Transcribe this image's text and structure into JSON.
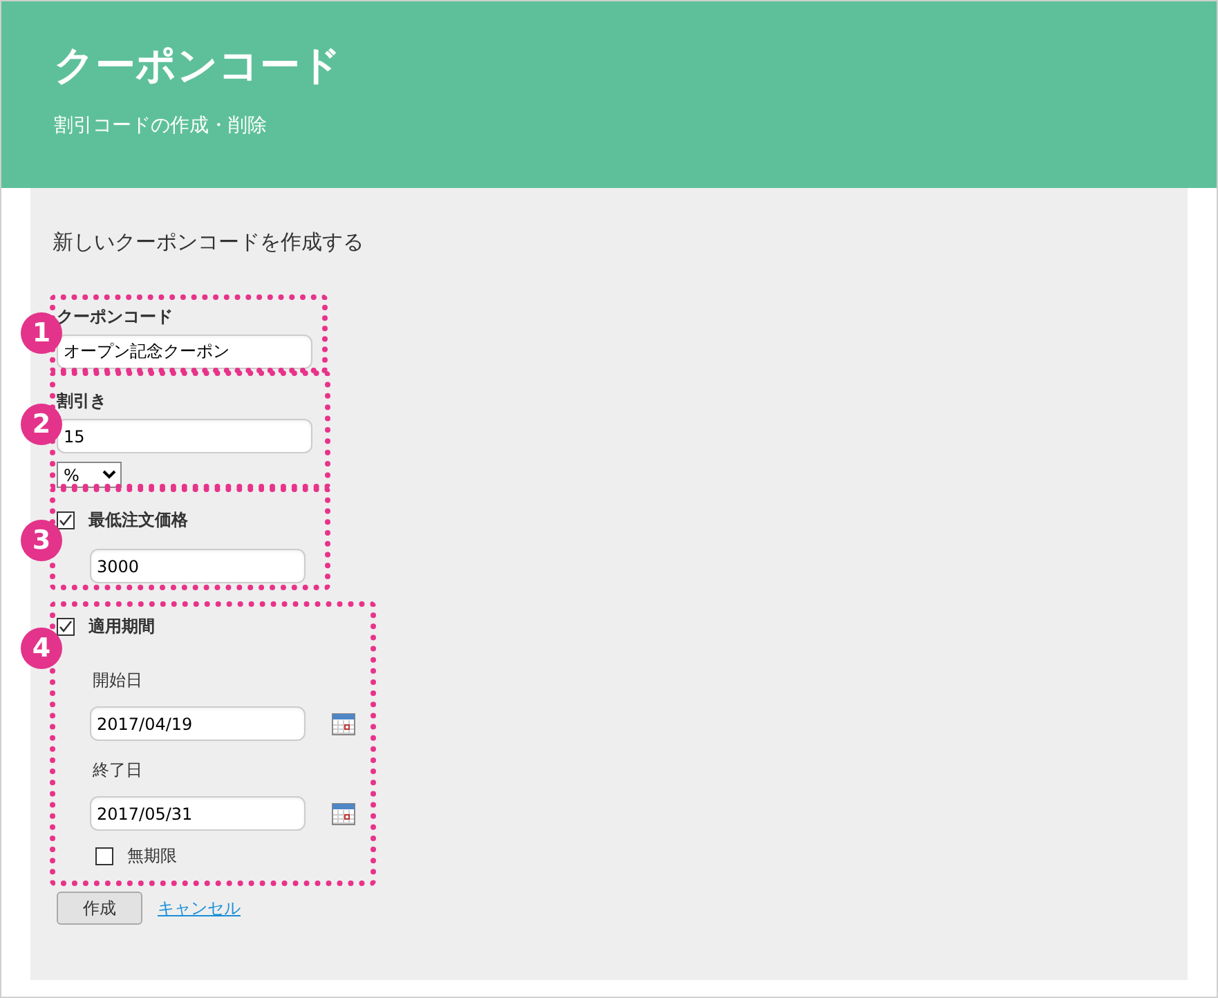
{
  "header": {
    "title": "クーポンコード",
    "subtitle": "割引コードの作成・削除"
  },
  "form": {
    "heading": "新しいクーポンコードを作成する",
    "code": {
      "label": "クーポンコード",
      "value": "オープン記念クーポン"
    },
    "discount": {
      "label": "割引き",
      "value": "15",
      "unit": "%"
    },
    "min_order": {
      "label": "最低注文価格",
      "checked": true,
      "value": "3000"
    },
    "period": {
      "label": "適用期間",
      "checked": true,
      "start_label": "開始日",
      "start": "2017/04/19",
      "end_label": "終了日",
      "end": "2017/05/31",
      "no_limit": {
        "label": "無期限",
        "checked": false
      }
    },
    "create_button": "作成",
    "cancel_link": "キャンセル"
  },
  "callouts": [
    {
      "number": "1"
    },
    {
      "number": "2"
    },
    {
      "number": "3"
    },
    {
      "number": "4"
    }
  ]
}
